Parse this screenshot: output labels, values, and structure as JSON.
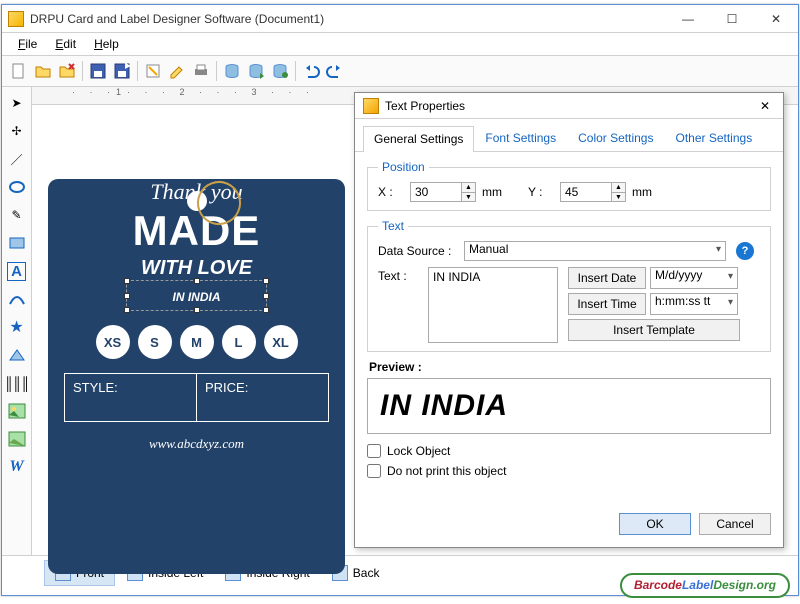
{
  "titlebar": {
    "title": "DRPU Card and Label Designer Software (Document1)"
  },
  "menu": {
    "file": "File",
    "edit": "Edit",
    "help": "Help"
  },
  "tag": {
    "thankyou": "Thank you",
    "made": "MADE",
    "withlove": "WITH LOVE",
    "inindia": "IN INDIA",
    "sizes": [
      "XS",
      "S",
      "M",
      "L",
      "XL"
    ],
    "style": "STYLE:",
    "price": "PRICE:",
    "url": "www.abcdxyz.com"
  },
  "pagetabs": {
    "front": "Front",
    "insideLeft": "Inside Left",
    "insideRight": "Inside Right",
    "back": "Back"
  },
  "dialog": {
    "title": "Text Properties",
    "tabs": {
      "general": "General Settings",
      "font": "Font Settings",
      "color": "Color Settings",
      "other": "Other Settings"
    },
    "position": {
      "legend": "Position",
      "xlabel": "X :",
      "x": "30",
      "ylabel": "Y :",
      "y": "45",
      "unit": "mm"
    },
    "text": {
      "legend": "Text",
      "dsLabel": "Data Source :",
      "dsValue": "Manual",
      "textLabel": "Text :",
      "textValue": "IN INDIA",
      "insertDate": "Insert Date",
      "dateFmt": "M/d/yyyy",
      "insertTime": "Insert Time",
      "timeFmt": "h:mm:ss tt",
      "insertTemplate": "Insert Template"
    },
    "previewLabel": "Preview :",
    "preview": "IN INDIA",
    "lock": "Lock Object",
    "noprint": "Do not print this object",
    "ok": "OK",
    "cancel": "Cancel"
  },
  "footer": {
    "b": "Barcode",
    "l": "Label",
    "d": "Design",
    "org": ".org"
  }
}
